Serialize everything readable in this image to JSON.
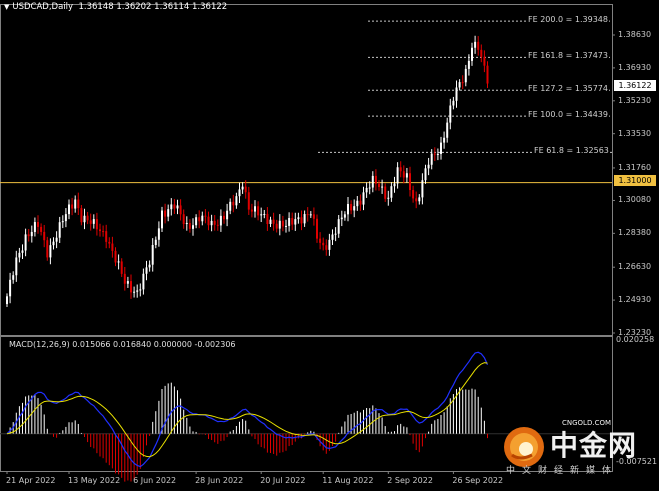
{
  "main": {
    "symbol": "USDCAD,Daily",
    "ohlc": "1.36148 1.36202 1.36114 1.36122"
  },
  "macd": {
    "title": "MACD(12,26,9) 0.015066 0.016840 0.000000 -0.002306",
    "scale_top": "0.020258",
    "scale_bottom": "-0.007521"
  },
  "price_axis": [
    "1.38630",
    "1.36930",
    "1.35230",
    "1.33530",
    "1.31760",
    "1.30080",
    "1.28380",
    "1.26630",
    "1.24930",
    "1.23230"
  ],
  "date_axis": [
    "21 Apr 2022",
    "13 May 2022",
    "6 Jun 2022",
    "28 Jun 2022",
    "20 Jul 2022",
    "11 Aug 2022",
    "2 Sep 2022",
    "26 Sep 2022"
  ],
  "fib_levels": [
    {
      "label": "FE 200.0 = 1.39348",
      "price": 1.39348
    },
    {
      "label": "FE 161.8 = 1.37473",
      "price": 1.37473
    },
    {
      "label": "FE 127.2 = 1.35774",
      "price": 1.35774
    },
    {
      "label": "FE 100.0 = 1.34439",
      "price": 1.34439
    },
    {
      "label": "FE 61.8 = 1.32563",
      "price": 1.32563
    }
  ],
  "horizontal_line": {
    "value": "1.31000",
    "price": 1.31,
    "color": "#f0c040"
  },
  "current_price": {
    "value": "1.36122",
    "price": 1.36122
  },
  "colors": {
    "bull": "#ffffff",
    "bear": "#e00000",
    "signal": "#e8e000",
    "macd_line": "#2030ff",
    "grid": "#808080"
  },
  "watermark": {
    "brand": "中金网",
    "url": "CNGOLD.COM",
    "tagline": "中文财经新媒体",
    "logo": "cngold-logo-icon"
  },
  "chart_data": {
    "type": "candlestick",
    "symbol": "USDCAD",
    "timeframe": "Daily",
    "ylim": [
      1.2323,
      1.4
    ],
    "x_labels": [
      "21 Apr 2022",
      "13 May 2022",
      "6 Jun 2022",
      "28 Jun 2022",
      "20 Jul 2022",
      "11 Aug 2022",
      "2 Sep 2022",
      "26 Sep 2022"
    ],
    "anchors": [
      [
        0,
        1.25
      ],
      [
        3,
        1.27
      ],
      [
        6,
        1.2825
      ],
      [
        10,
        1.2875
      ],
      [
        13,
        1.2745
      ],
      [
        18,
        1.29
      ],
      [
        22,
        1.3015
      ],
      [
        24,
        1.293
      ],
      [
        28,
        1.2875
      ],
      [
        32,
        1.283
      ],
      [
        36,
        1.266
      ],
      [
        38,
        1.258
      ],
      [
        42,
        1.254
      ],
      [
        46,
        1.268
      ],
      [
        50,
        1.295
      ],
      [
        54,
        1.2975
      ],
      [
        58,
        1.288
      ],
      [
        62,
        1.2915
      ],
      [
        66,
        1.2885
      ],
      [
        70,
        1.293
      ],
      [
        74,
        1.301
      ],
      [
        76,
        1.311
      ],
      [
        78,
        1.298
      ],
      [
        82,
        1.292
      ],
      [
        86,
        1.29
      ],
      [
        90,
        1.287
      ],
      [
        94,
        1.292
      ],
      [
        98,
        1.2945
      ],
      [
        100,
        1.281
      ],
      [
        102,
        1.276
      ],
      [
        106,
        1.286
      ],
      [
        110,
        1.296
      ],
      [
        114,
        1.302
      ],
      [
        118,
        1.31
      ],
      [
        120,
        1.309
      ],
      [
        123,
        1.303
      ],
      [
        126,
        1.315
      ],
      [
        129,
        1.313
      ],
      [
        132,
        1.2995
      ],
      [
        136,
        1.32
      ],
      [
        140,
        1.33
      ],
      [
        144,
        1.353
      ],
      [
        148,
        1.368
      ],
      [
        150,
        1.382
      ],
      [
        152,
        1.3795
      ],
      [
        155,
        1.3615
      ]
    ],
    "macd": {
      "ylim": [
        -0.007521,
        0.020258
      ],
      "last_macd": 0.015066,
      "last_signal": 0.01684,
      "last_hist": -0.002306
    }
  }
}
